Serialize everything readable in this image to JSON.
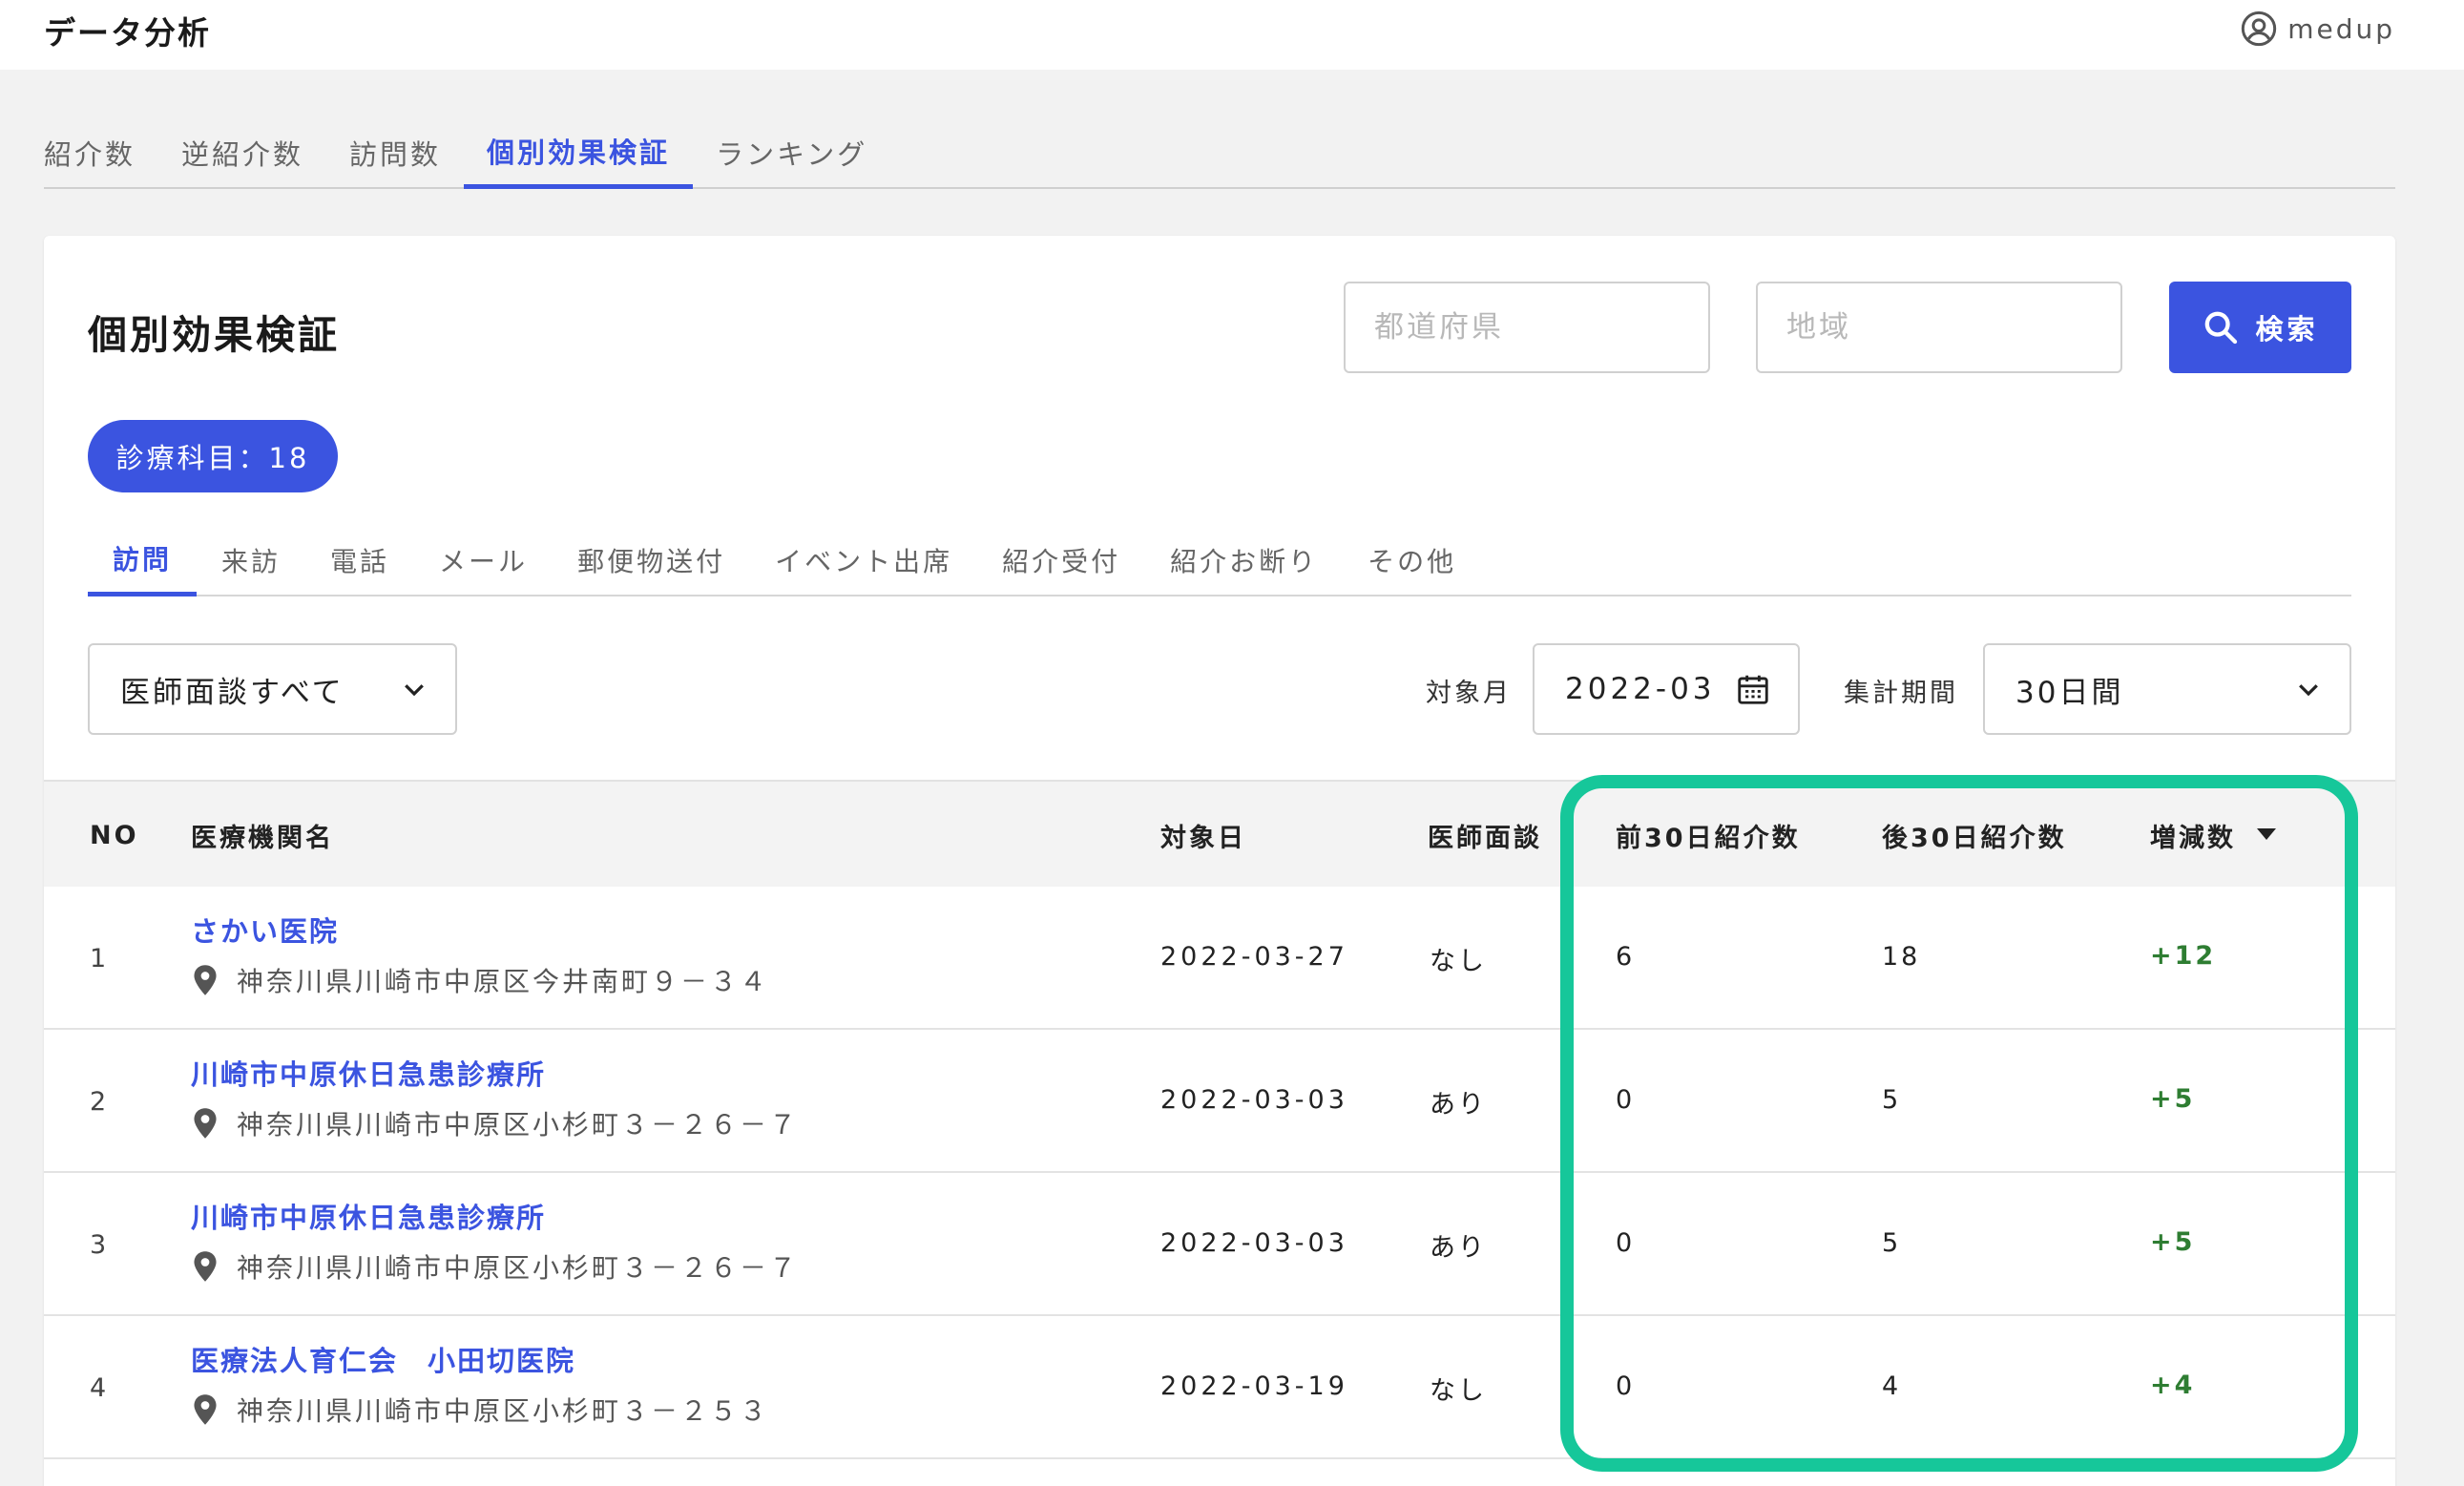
{
  "header": {
    "title": "データ分析",
    "user": "medup"
  },
  "main_tabs": [
    {
      "label": "紹介数",
      "active": false
    },
    {
      "label": "逆紹介数",
      "active": false
    },
    {
      "label": "訪問数",
      "active": false
    },
    {
      "label": "個別効果検証",
      "active": true
    },
    {
      "label": "ランキング",
      "active": false
    }
  ],
  "card": {
    "title": "個別効果検証",
    "prefecture_placeholder": "都道府県",
    "area_placeholder": "地域",
    "search_label": "検索",
    "badge": "診療科目：18"
  },
  "sub_tabs": [
    {
      "label": "訪問",
      "active": true
    },
    {
      "label": "来訪",
      "active": false
    },
    {
      "label": "電話",
      "active": false
    },
    {
      "label": "メール",
      "active": false
    },
    {
      "label": "郵便物送付",
      "active": false
    },
    {
      "label": "イベント出席",
      "active": false
    },
    {
      "label": "紹介受付",
      "active": false
    },
    {
      "label": "紹介お断り",
      "active": false
    },
    {
      "label": "その他",
      "active": false
    }
  ],
  "filters": {
    "doctor_select": "医師面談すべて",
    "month_label": "対象月",
    "month_value": "2022-03",
    "period_label": "集計期間",
    "period_value": "30日間"
  },
  "table": {
    "headers": {
      "no": "NO",
      "name": "医療機関名",
      "date": "対象日",
      "doctor": "医師面談",
      "prev": "前30日紹介数",
      "next": "後30日紹介数",
      "diff": "増減数"
    },
    "rows": [
      {
        "no": "1",
        "name": "さかい医院",
        "address": "神奈川県川崎市中原区今井南町９－３４",
        "date": "2022-03-27",
        "doctor": "なし",
        "prev": "6",
        "next": "18",
        "diff": "+12"
      },
      {
        "no": "2",
        "name": "川崎市中原休日急患診療所",
        "address": "神奈川県川崎市中原区小杉町３－２６－７",
        "date": "2022-03-03",
        "doctor": "あり",
        "prev": "0",
        "next": "5",
        "diff": "+5"
      },
      {
        "no": "3",
        "name": "川崎市中原休日急患診療所",
        "address": "神奈川県川崎市中原区小杉町３－２６－７",
        "date": "2022-03-03",
        "doctor": "あり",
        "prev": "0",
        "next": "5",
        "diff": "+5"
      },
      {
        "no": "4",
        "name": "医療法人育仁会　小田切医院",
        "address": "神奈川県川崎市中原区小杉町３－２５３",
        "date": "2022-03-19",
        "doctor": "なし",
        "prev": "0",
        "next": "4",
        "diff": "+4"
      }
    ]
  },
  "colors": {
    "accent": "#3b54e0",
    "positive": "#2e7d32",
    "highlight": "#16c79a"
  }
}
